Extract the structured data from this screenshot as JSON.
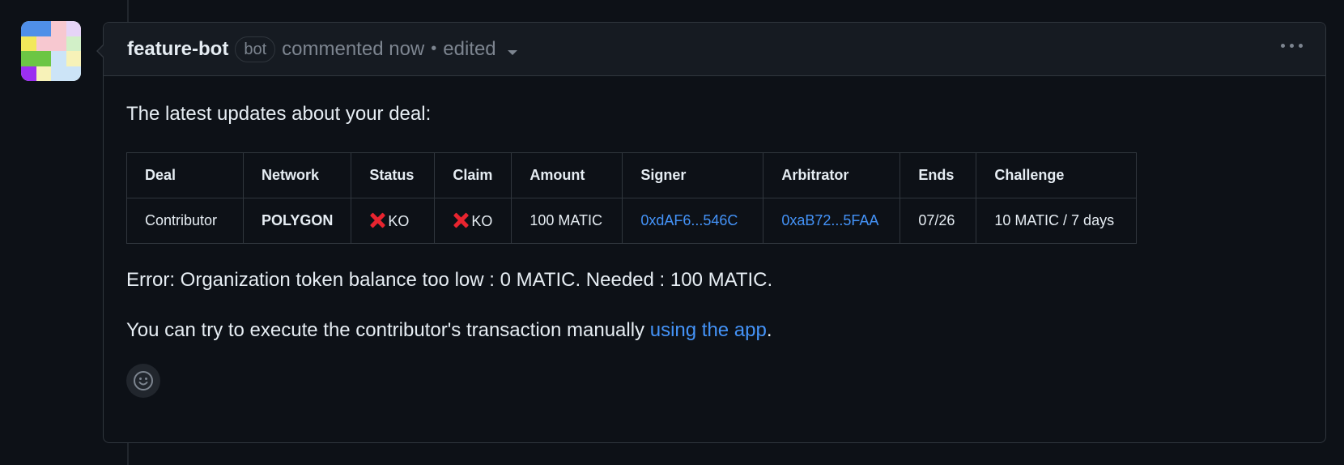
{
  "comment": {
    "author": "feature-bot",
    "badge": "bot",
    "action": "commented now",
    "separator": "•",
    "edited": "edited"
  },
  "body": {
    "intro": "The latest updates about your deal:",
    "table": {
      "headers": [
        "Deal",
        "Network",
        "Status",
        "Claim",
        "Amount",
        "Signer",
        "Arbitrator",
        "Ends",
        "Challenge"
      ],
      "row": {
        "deal": "Contributor",
        "network": "POLYGON",
        "status": "KO",
        "claim": "KO",
        "amount": "100 MATIC",
        "signer": "0xdAF6...546C",
        "arbitrator": "0xaB72...5FAA",
        "ends": "07/26",
        "challenge": "10 MATIC / 7 days"
      }
    },
    "error": "Error: Organization token balance too low : 0 MATIC. Needed : 100 MATIC.",
    "try_text": "You can try to execute the contributor's transaction manually",
    "try_link": "using the app",
    "try_end": "."
  },
  "colors": {
    "background": "#0d1117",
    "header_bg": "#161b22",
    "border": "#30363d",
    "link": "#4493f8",
    "ko_mark": "#e8242f"
  },
  "icons": {
    "status": "x-mark-icon",
    "claim": "x-mark-icon",
    "more": "kebab-horizontal-icon",
    "reaction": "smiley-icon",
    "dropdown": "triangle-down-icon"
  }
}
